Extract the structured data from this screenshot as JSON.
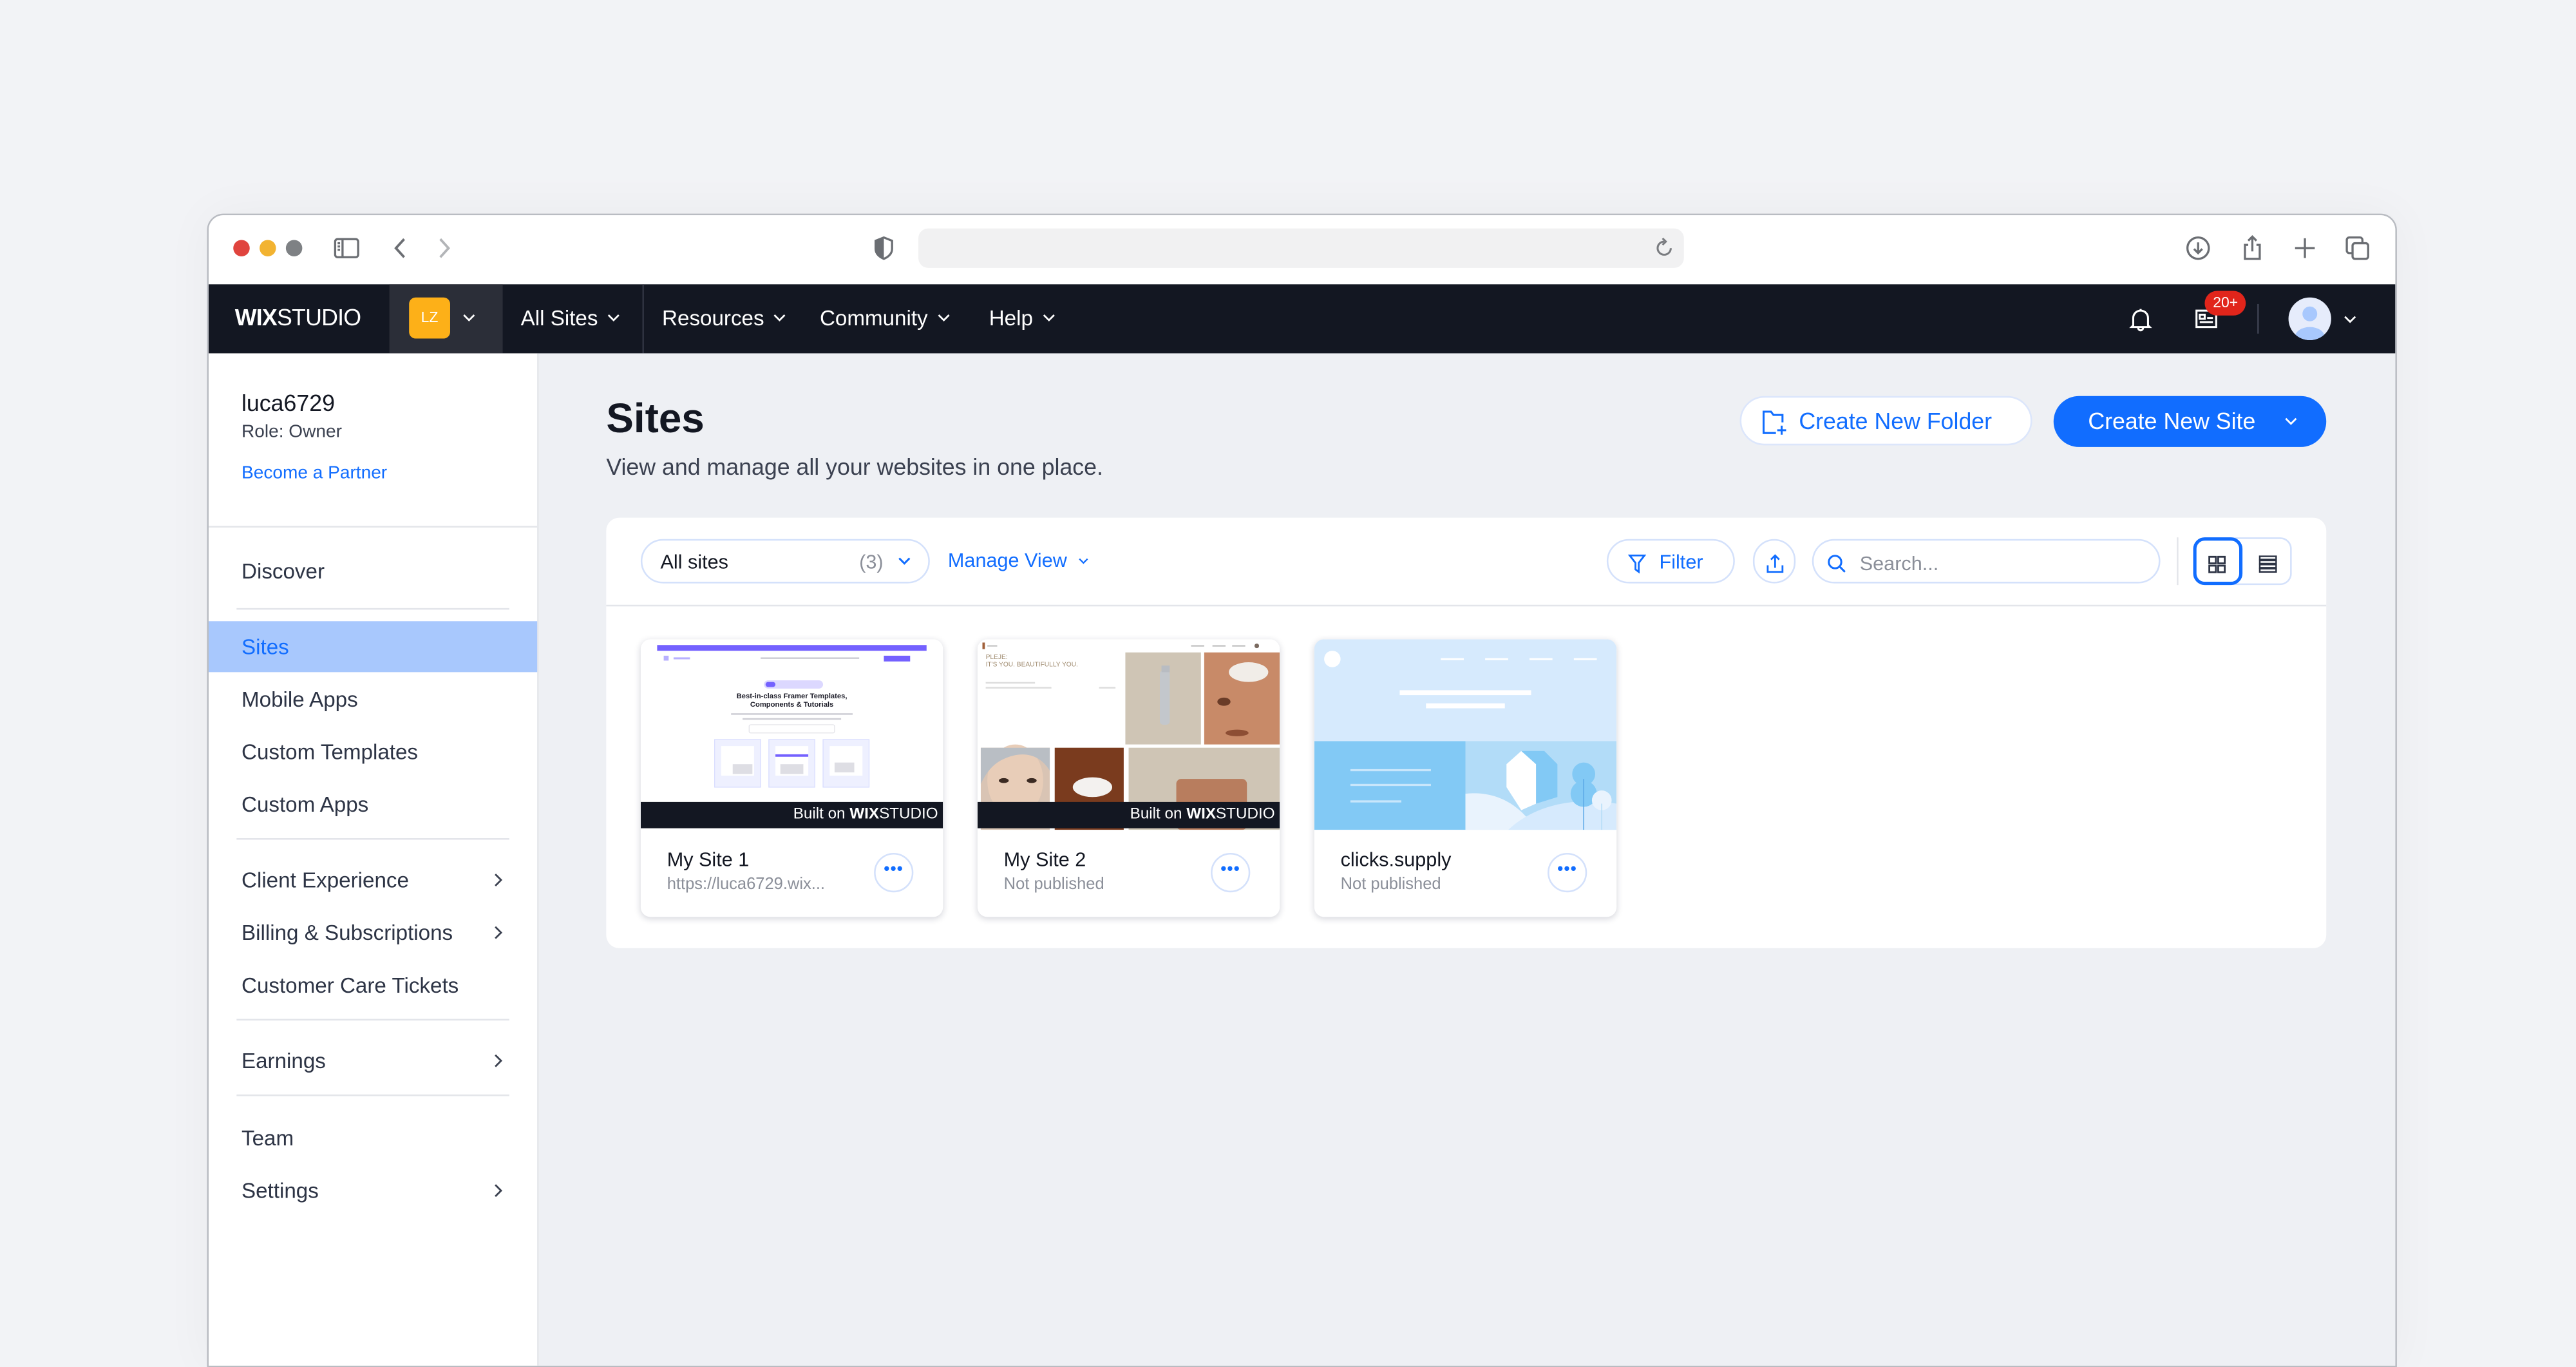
{
  "browser": {
    "url": "",
    "icons": [
      "sidebar-icon",
      "back-icon",
      "forward-icon",
      "shield-icon",
      "reload-icon",
      "download-icon",
      "share-icon",
      "new-tab-icon",
      "tabs-overview-icon"
    ]
  },
  "nav": {
    "logo_bold": "WIX",
    "logo_light": "STUDIO",
    "account_initials": "LZ",
    "items": [
      {
        "label": "All Sites"
      },
      {
        "label": "Resources"
      },
      {
        "label": "Community"
      },
      {
        "label": "Help"
      }
    ],
    "inbox_badge": "20+",
    "colors": {
      "bar": "#131722",
      "account_avatar": "#fdb018",
      "badge": "#e1251b"
    }
  },
  "sidebar": {
    "username": "luca6729",
    "role": "Role: Owner",
    "partner_link": "Become a Partner",
    "items": [
      {
        "label": "Discover",
        "arrow": false
      },
      {
        "label": "Sites",
        "arrow": false,
        "active": true
      },
      {
        "label": "Mobile Apps",
        "arrow": false
      },
      {
        "label": "Custom Templates",
        "arrow": false
      },
      {
        "label": "Custom Apps",
        "arrow": false
      },
      {
        "label": "Client Experience",
        "arrow": true
      },
      {
        "label": "Billing & Subscriptions",
        "arrow": true
      },
      {
        "label": "Customer Care Tickets",
        "arrow": false
      },
      {
        "label": "Earnings",
        "arrow": true
      },
      {
        "label": "Team",
        "arrow": false
      },
      {
        "label": "Settings",
        "arrow": true
      }
    ]
  },
  "main": {
    "title": "Sites",
    "subtitle": "View and manage all your websites in one place.",
    "create_folder_label": "Create New Folder",
    "create_site_label": "Create New Site",
    "toolbar": {
      "filter_select": "All sites",
      "filter_count": "(3)",
      "manage_view": "Manage View",
      "filter_label": "Filter",
      "search_placeholder": "Search...",
      "view_mode": "grid"
    },
    "sites": [
      {
        "name": "My Site 1",
        "status": "https://luca6729.wix...",
        "built_on": "Built on",
        "preview": "framer-templates"
      },
      {
        "name": "My Site 2",
        "status": "Not published",
        "built_on": "Built on",
        "preview": "pleje-skincare"
      },
      {
        "name": "clicks.supply",
        "status": "Not published",
        "built_on": "",
        "preview": "blank-illustration"
      }
    ],
    "preview_text": {
      "site1_headline": "Best-in-class Framer Templates, Components & Tutorials",
      "site2_headline": "PLEJE: IT'S YOU. BEAUTIFULLY YOU."
    },
    "accent_color": "#116dff"
  }
}
